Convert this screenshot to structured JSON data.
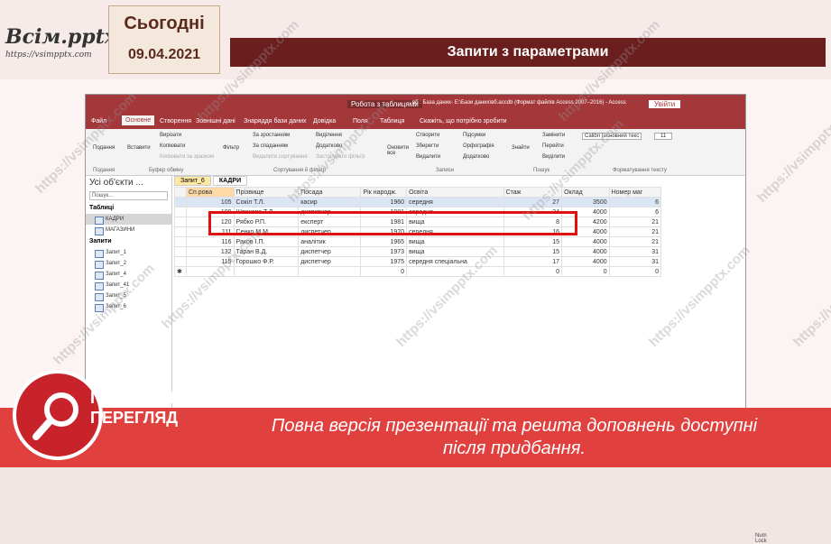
{
  "logo": {
    "title": "Всім.pptx",
    "url": "https://vsimpptx.com"
  },
  "date": {
    "label": "Сьогодні",
    "value": "09.04.2021"
  },
  "slide_title": "Запити з параметрами",
  "access": {
    "title_left": "Робота з таблицями",
    "title_mid": "вб : База даних- E:\\Бази даних\\вб.accdb (Формат файлів Access 2007–2016) - Access",
    "signin": "Увійти",
    "tabs": [
      "Файл",
      "Основне",
      "Створення",
      "Зовнішні дані",
      "Знаряддя бази даних",
      "Довідка",
      "Поля",
      "Таблиця",
      "Скажіть, що потрібно зробити"
    ],
    "ribbon": {
      "view": "Подання",
      "paste": "Вставити",
      "cut": "Вирізати",
      "copy": "Копіювати",
      "format": "Копіювати за зразком",
      "filter": "Фільтр",
      "asc": "За зростанням",
      "desc": "За спаданням",
      "sel": "Виділення",
      "adv": "Додатково",
      "toggle": "Застосувати фільтр",
      "remove": "Видалити сортування",
      "refresh": "Оновити все",
      "new": "Створити",
      "save": "Зберегти",
      "delete": "Видалити",
      "totals": "Підсумки",
      "spell": "Орфографія",
      "more": "Додатково",
      "find": "Знайти",
      "replace": "Замінити",
      "goto": "Перейти",
      "select": "Виділити",
      "font": "Calibri (основний текс",
      "size": "11",
      "g1": "Подання",
      "g2": "Буфер обміну",
      "g3": "Сортування й фільтр",
      "g4": "Записи",
      "g5": "Пошук",
      "g6": "Форматування тексту"
    },
    "nav": {
      "header": "Усі об'єкти ...",
      "search": "Пошук...",
      "tables_label": "Таблиці",
      "tables": [
        "КАДРИ",
        "МАГАЗИНИ"
      ],
      "queries_label": "Запити",
      "queries": [
        "Запит_1",
        "Запит_2",
        "Запит_4",
        "Запит_41",
        "Запит_5",
        "Запит_6"
      ]
    },
    "doc_tabs": [
      "Запит_6",
      "КАДРИ"
    ],
    "columns": [
      "Сп.рова",
      "Прізвище",
      "Посада",
      "Рік народж.",
      "Освіта",
      "Стаж",
      "Оклад",
      "Номер маг"
    ],
    "rows": [
      [
        "105",
        "Сокіл Т.Л.",
        "касир",
        "1960",
        "середня",
        "27",
        "3500",
        "6"
      ],
      [
        "109",
        "Шпакова Т.Л.",
        "диспетчер",
        "1981",
        "середня",
        "24",
        "4000",
        "6"
      ],
      [
        "120",
        "Рябко Р.П.",
        "експерт",
        "1981",
        "вища",
        "8",
        "4200",
        "21"
      ],
      [
        "111",
        "Сенко М.М.",
        "диспетчер",
        "1970",
        "середня",
        "16",
        "4000",
        "21"
      ],
      [
        "116",
        "Раков І.П.",
        "аналітик",
        "1965",
        "вища",
        "15",
        "4000",
        "21"
      ],
      [
        "132",
        "Таран В.Д.",
        "диспетчер",
        "1973",
        "вища",
        "15",
        "4000",
        "31"
      ],
      [
        "115",
        "Горошко Ф.Р.",
        "диспетчер",
        "1975",
        "середня спеціальна",
        "17",
        "4000",
        "31"
      ],
      [
        "",
        "",
        "",
        "0",
        "",
        "0",
        "0",
        "0"
      ]
    ],
    "status": "Num Lock"
  },
  "preview": {
    "line1": "ПОПЕРЕДНІЙ",
    "line2": "ПЕРЕГЛЯД"
  },
  "message": "Повна версія презентації та решта доповнень доступні після придбання.",
  "watermark": "https://vsimpptx.com"
}
